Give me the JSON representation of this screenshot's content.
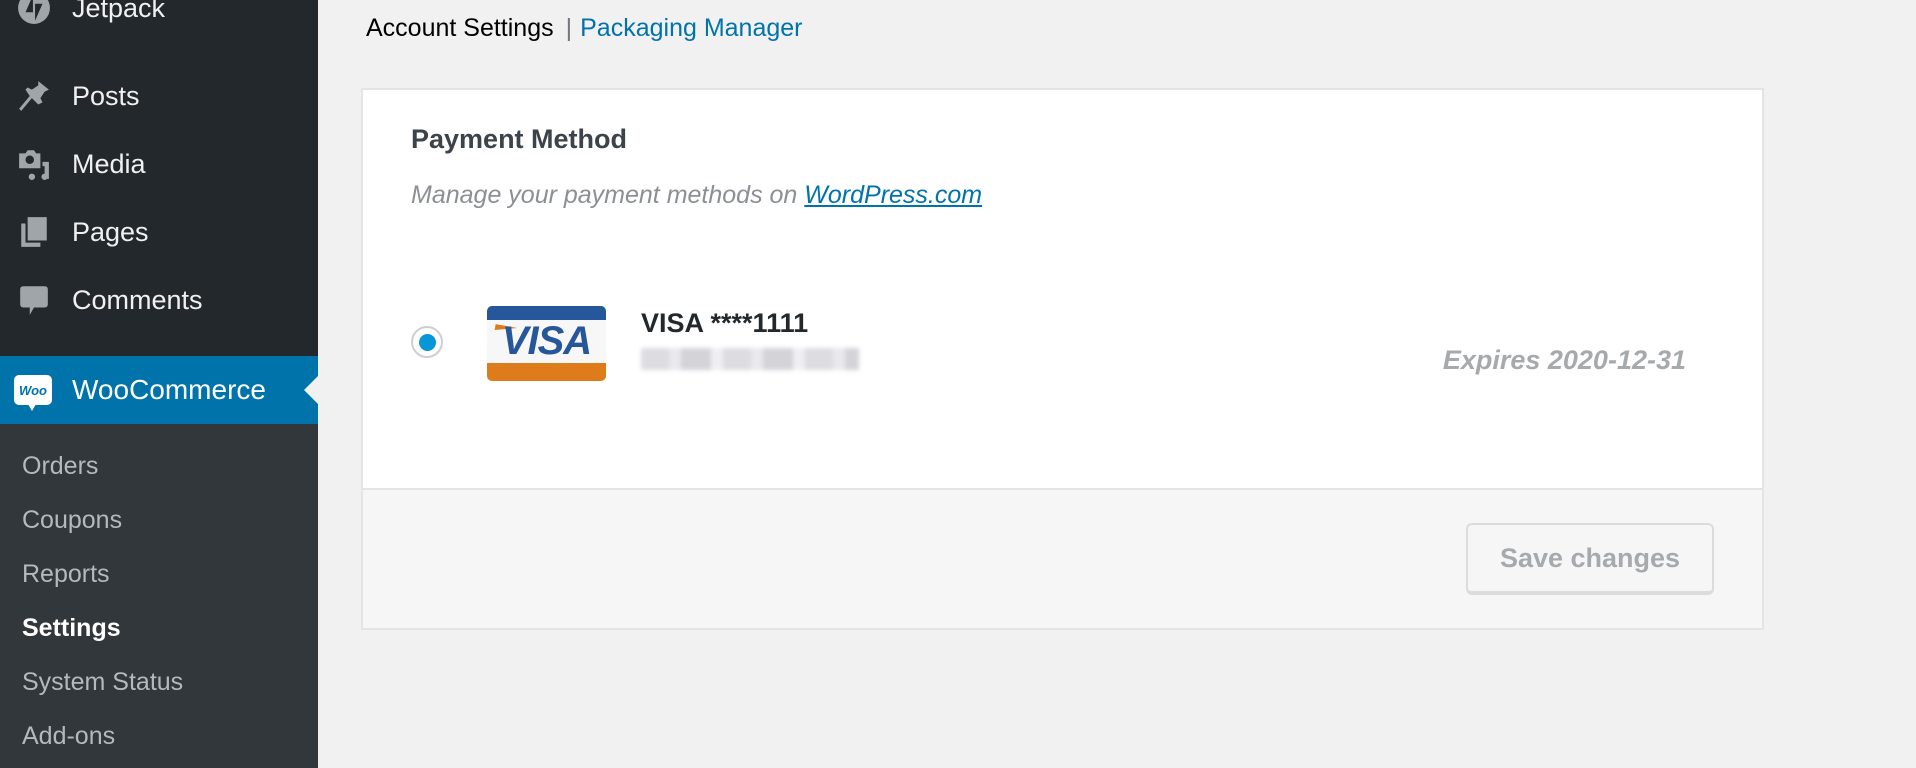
{
  "sidebar": {
    "items": [
      {
        "label": "Jetpack",
        "icon": "jetpack-icon"
      },
      {
        "label": "Posts",
        "icon": "pushpin-icon"
      },
      {
        "label": "Media",
        "icon": "media-icon"
      },
      {
        "label": "Pages",
        "icon": "pages-icon"
      },
      {
        "label": "Comments",
        "icon": "comment-icon"
      }
    ],
    "active": {
      "label": "WooCommerce",
      "badge": "Woo",
      "icon": "woocommerce-icon"
    },
    "submenu": [
      {
        "label": "Orders"
      },
      {
        "label": "Coupons"
      },
      {
        "label": "Reports"
      },
      {
        "label": "Settings",
        "current": true
      },
      {
        "label": "System Status"
      },
      {
        "label": "Add-ons"
      }
    ]
  },
  "tabs": {
    "current": "Account Settings",
    "separator": "|",
    "other": "Packaging Manager"
  },
  "payment": {
    "title": "Payment Method",
    "description": "Manage your payment methods on",
    "link_text": "WordPress.com",
    "card": {
      "brand_logo_text": "VISA",
      "name": "VISA ****1111",
      "holder_name_redacted": true,
      "expiry": "Expires 2020-12-31",
      "selected": true
    },
    "save_label": "Save changes"
  },
  "colors": {
    "accent": "#0073aa",
    "sidebar_bg": "#23282d",
    "submenu_bg": "#32373c",
    "radio_dot": "#0996d7",
    "visa_blue": "#26579a",
    "visa_orange": "#de7c1b"
  }
}
